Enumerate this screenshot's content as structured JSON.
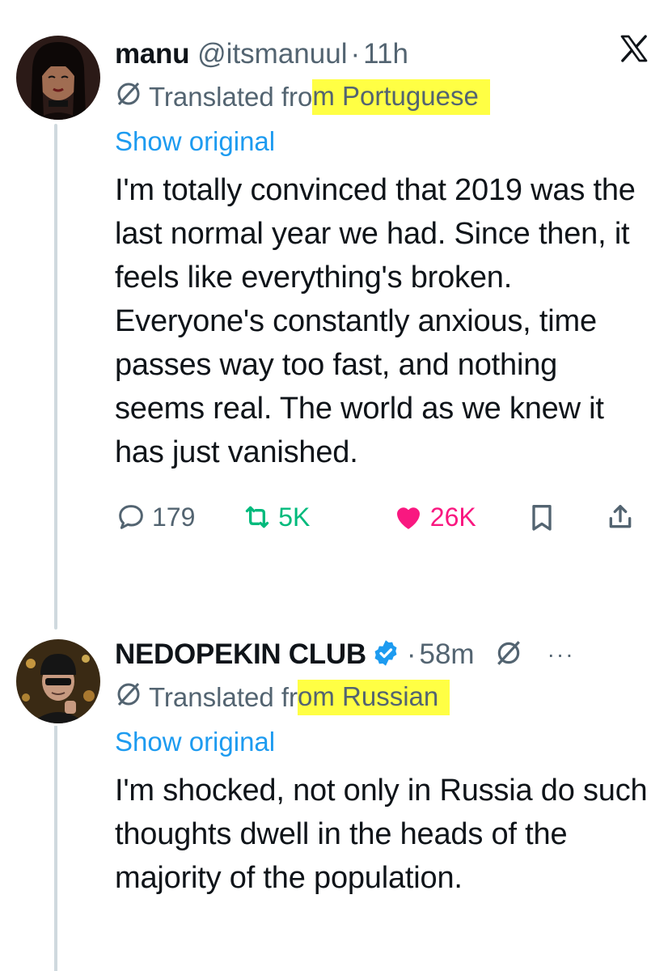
{
  "tweet1": {
    "display_name": "manu",
    "handle": "@itsmanuul",
    "separator": "·",
    "time": "11h",
    "translated_prefix": "Translated fro",
    "translated_suffix": "m Portuguese",
    "show_original": "Show original",
    "text": "I'm totally convinced that 2019 was the last normal year we had. Since then, it feels like everything's broken. Everyone's constantly anxious, time passes way too fast, and nothing seems real. The world as we knew it has just vanished.",
    "replies": "179",
    "reposts": "5K",
    "likes": "26K"
  },
  "tweet2": {
    "display_name": "NEDOPEKIN CLUB",
    "separator": "·",
    "time": "58m",
    "more": "···",
    "translated_prefix": "Translated fr",
    "translated_suffix": "om Russian",
    "show_original": "Show original",
    "text": "I'm shocked, not only in Russia do such thoughts dwell in the heads of the majority of the population."
  },
  "colors": {
    "link": "#1d9bf0",
    "muted": "#536471",
    "repost": "#00ba7c",
    "like": "#f91880",
    "highlight": "#ffff44",
    "verified": "#1d9bf0"
  },
  "icons": {
    "x_logo": "x-logo-icon",
    "globe": "translate-icon",
    "reply": "reply-icon",
    "repost": "repost-icon",
    "like": "heart-icon",
    "bookmark": "bookmark-icon",
    "share": "share-icon",
    "verified": "verified-badge-icon",
    "grok": "grok-icon"
  }
}
